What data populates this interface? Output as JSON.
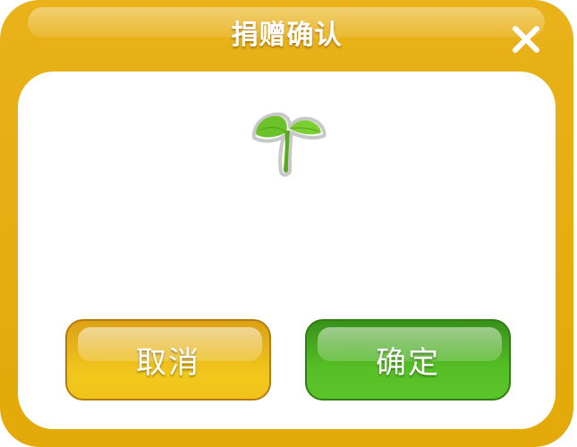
{
  "dialog": {
    "title": "捐赠确认",
    "close_icon": "close-icon",
    "item_icon": "sprout-icon",
    "buttons": {
      "cancel_label": "取消",
      "confirm_label": "确定"
    }
  },
  "colors": {
    "frame": "#e3a908",
    "cancel_button": "#f0c31a",
    "confirm_button": "#56bf25",
    "sprout_leaf": "#6cc22a"
  }
}
